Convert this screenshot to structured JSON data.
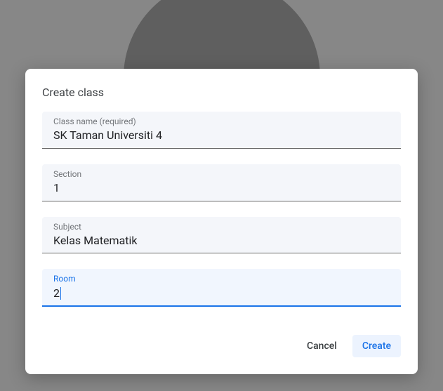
{
  "dialog": {
    "title": "Create class",
    "fields": {
      "class_name": {
        "label": "Class name (required)",
        "value": "SK Taman Universiti 4"
      },
      "section": {
        "label": "Section",
        "value": "1"
      },
      "subject": {
        "label": "Subject",
        "value": "Kelas Matematik"
      },
      "room": {
        "label": "Room",
        "value": "2",
        "focused": true
      }
    },
    "actions": {
      "cancel": "Cancel",
      "create": "Create"
    }
  }
}
